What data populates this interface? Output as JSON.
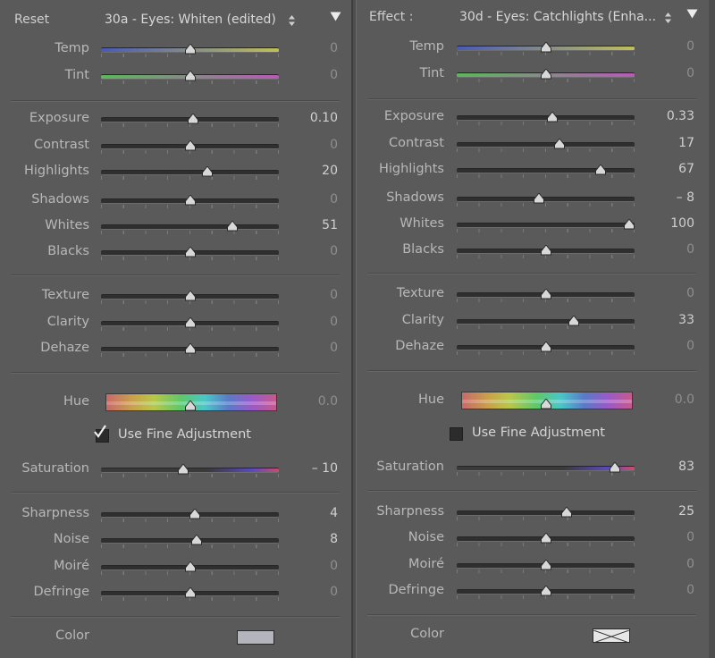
{
  "left_panel": {
    "header": {
      "label": "Reset",
      "preset": "30a - Eyes: Whiten (edited)"
    },
    "sliders": {
      "temp": {
        "label": "Temp",
        "value": "0",
        "pos": 0.5
      },
      "tint": {
        "label": "Tint",
        "value": "0",
        "pos": 0.5
      },
      "exposure": {
        "label": "Exposure",
        "value": "0.10",
        "pos": 0.52
      },
      "contrast": {
        "label": "Contrast",
        "value": "0",
        "pos": 0.5
      },
      "highlights": {
        "label": "Highlights",
        "value": "20",
        "pos": 0.6
      },
      "shadows": {
        "label": "Shadows",
        "value": "0",
        "pos": 0.5
      },
      "whites": {
        "label": "Whites",
        "value": "51",
        "pos": 0.74
      },
      "blacks": {
        "label": "Blacks",
        "value": "0",
        "pos": 0.5
      },
      "texture": {
        "label": "Texture",
        "value": "0",
        "pos": 0.5
      },
      "clarity": {
        "label": "Clarity",
        "value": "0",
        "pos": 0.5
      },
      "dehaze": {
        "label": "Dehaze",
        "value": "0",
        "pos": 0.5
      },
      "hue": {
        "label": "Hue",
        "value": "0.0",
        "pos": 0.5
      },
      "saturation": {
        "label": "Saturation",
        "value": "– 10",
        "pos": 0.46
      },
      "sharpness": {
        "label": "Sharpness",
        "value": "4",
        "pos": 0.53
      },
      "noise": {
        "label": "Noise",
        "value": "8",
        "pos": 0.54
      },
      "moire": {
        "label": "Moiré",
        "value": "0",
        "pos": 0.5
      },
      "defringe": {
        "label": "Defringe",
        "value": "0",
        "pos": 0.5
      }
    },
    "fine_adjustment": {
      "label": "Use Fine Adjustment",
      "checked": true
    },
    "color": {
      "label": "Color",
      "swatch": "#b4b4bc"
    }
  },
  "right_panel": {
    "header": {
      "label": "Effect :",
      "preset": "30d - Eyes: Catchlights (Enha..."
    },
    "sliders": {
      "temp": {
        "label": "Temp",
        "value": "0",
        "pos": 0.5
      },
      "tint": {
        "label": "Tint",
        "value": "0",
        "pos": 0.5
      },
      "exposure": {
        "label": "Exposure",
        "value": "0.33",
        "pos": 0.54
      },
      "contrast": {
        "label": "Contrast",
        "value": "17",
        "pos": 0.58
      },
      "highlights": {
        "label": "Highlights",
        "value": "67",
        "pos": 0.81
      },
      "shadows": {
        "label": "Shadows",
        "value": "– 8",
        "pos": 0.46
      },
      "whites": {
        "label": "Whites",
        "value": "100",
        "pos": 0.97
      },
      "blacks": {
        "label": "Blacks",
        "value": "0",
        "pos": 0.5
      },
      "texture": {
        "label": "Texture",
        "value": "0",
        "pos": 0.5
      },
      "clarity": {
        "label": "Clarity",
        "value": "33",
        "pos": 0.66
      },
      "dehaze": {
        "label": "Dehaze",
        "value": "0",
        "pos": 0.5
      },
      "hue": {
        "label": "Hue",
        "value": "0.0",
        "pos": 0.5
      },
      "saturation": {
        "label": "Saturation",
        "value": "83",
        "pos": 0.89
      },
      "sharpness": {
        "label": "Sharpness",
        "value": "25",
        "pos": 0.62
      },
      "noise": {
        "label": "Noise",
        "value": "0",
        "pos": 0.5
      },
      "moire": {
        "label": "Moiré",
        "value": "0",
        "pos": 0.5
      },
      "defringe": {
        "label": "Defringe",
        "value": "0",
        "pos": 0.5
      }
    },
    "fine_adjustment": {
      "label": "Use Fine Adjustment",
      "checked": false
    },
    "color": {
      "label": "Color",
      "swatch": "none"
    }
  },
  "icons": {
    "updown": "updown-arrows-icon",
    "menu": "triangle-down-icon",
    "check": "checkmark-icon"
  }
}
